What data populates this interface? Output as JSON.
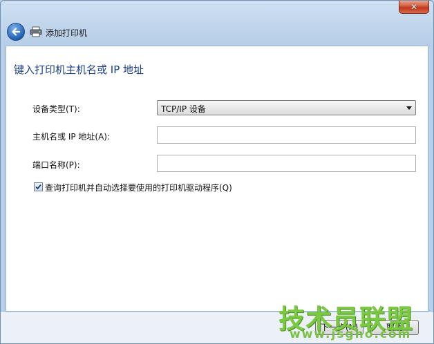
{
  "window": {
    "ghost_title": "",
    "close_symbol": "✕"
  },
  "navbar": {
    "title": "添加打印机",
    "back_icon": "back-arrow-icon",
    "app_icon": "printer-icon"
  },
  "page": {
    "heading": "键入打印机主机名或 IP 地址",
    "device_type": {
      "label": "设备类型(T):",
      "value": "TCP/IP 设备"
    },
    "hostname": {
      "label": "主机名或 IP 地址(A):",
      "value": ""
    },
    "port_name": {
      "label": "端口名称(P):",
      "value": ""
    },
    "auto_driver": {
      "label": "查询打印机并自动选择要使用的打印机驱动程序(Q)",
      "checked": true
    }
  },
  "footer": {
    "next_label": "下一步(N)",
    "cancel_label": "取消"
  },
  "watermark": {
    "title": "技术员联盟",
    "url": "www.jsgho.com"
  }
}
